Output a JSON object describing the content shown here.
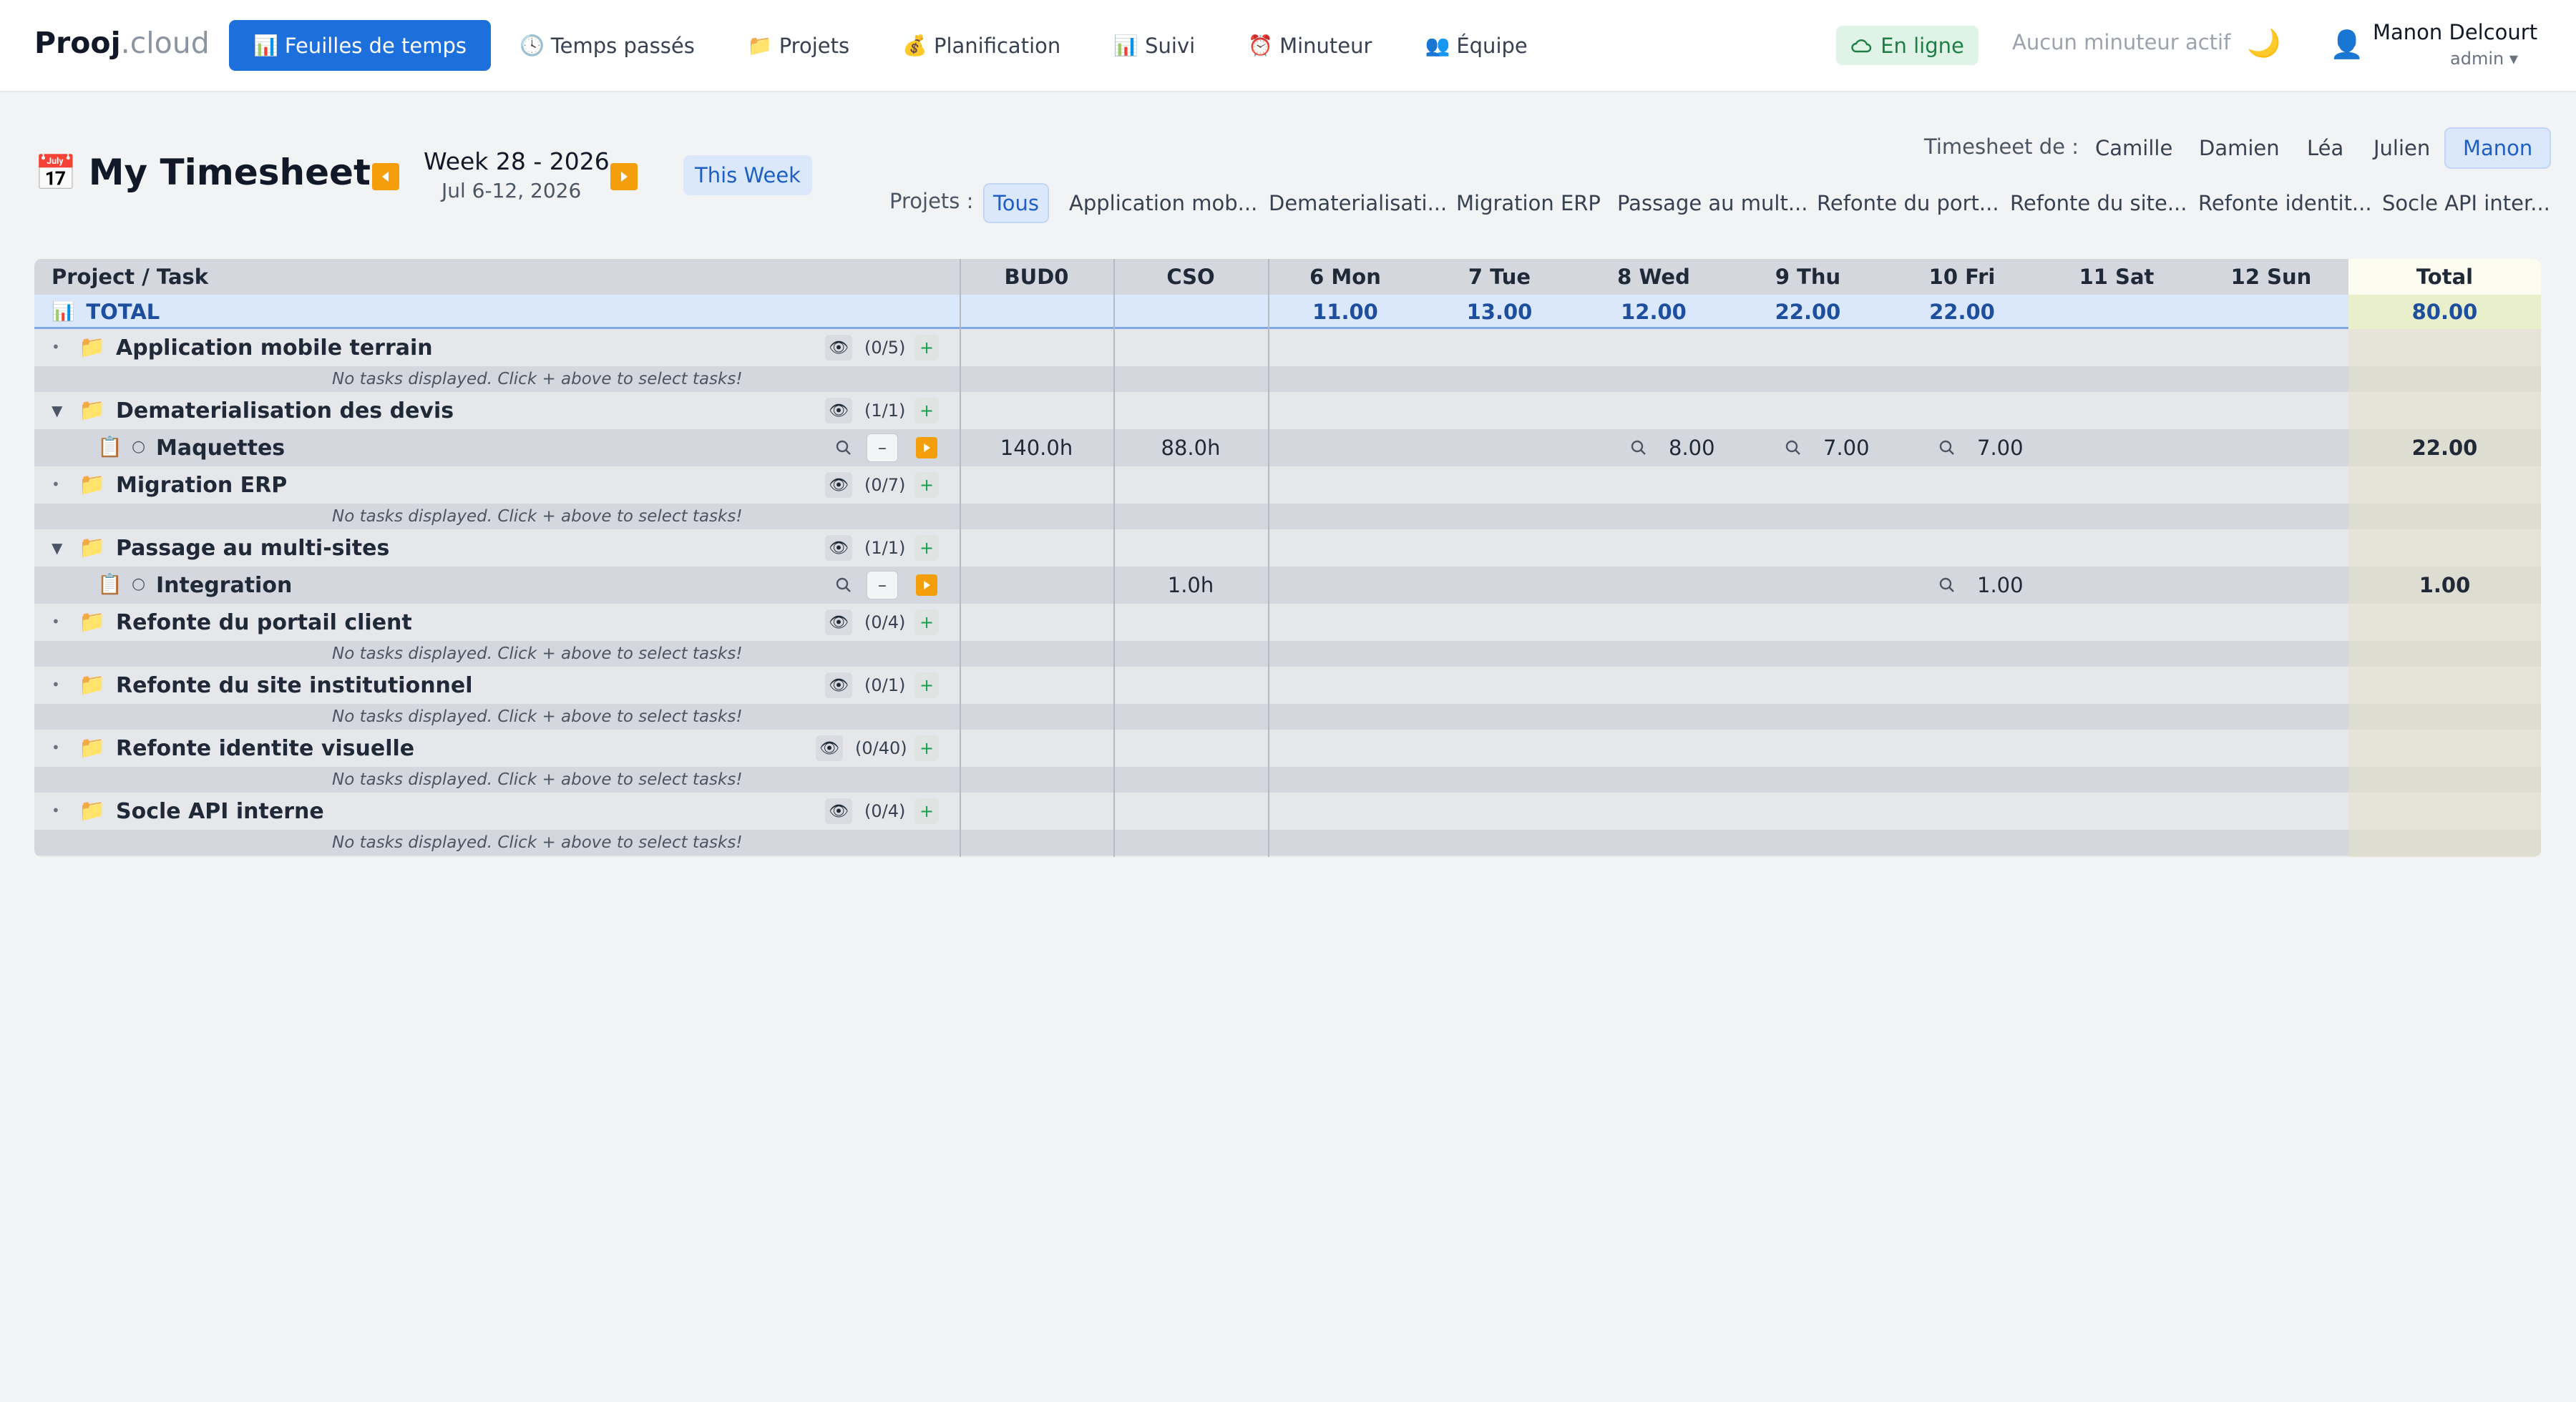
{
  "app": {
    "logo_bold": "Prooj",
    "logo_dim": ".cloud"
  },
  "nav": {
    "items": [
      {
        "icon": "📊",
        "label": "Feuilles de temps",
        "active": true
      },
      {
        "icon": "🕓",
        "label": "Temps passés"
      },
      {
        "icon": "📁",
        "label": "Projets"
      },
      {
        "icon": "💰",
        "label": "Planification"
      },
      {
        "icon": "📊",
        "label": "Suivi"
      },
      {
        "icon": "⏰",
        "label": "Minuteur"
      },
      {
        "icon": "👥",
        "label": "Équipe"
      }
    ],
    "status": "En ligne",
    "timer": "Aucun minuteur actif",
    "user_name": "Manon Delcourt",
    "user_role": "admin ▾"
  },
  "header": {
    "title": "My Timesheet",
    "week": "Week 28 - 2026",
    "dates": "Jul 6-12, 2026",
    "this_week": "This Week",
    "timesheet_of_label": "Timesheet de :",
    "people": [
      "Camille",
      "Damien",
      "Léa",
      "Julien",
      "Manon"
    ],
    "active_person": "Manon",
    "projects_label": "Projets :",
    "project_filters": [
      "Tous",
      "Application mob...",
      "Dematerialisati...",
      "Migration ERP",
      "Passage au mult...",
      "Refonte du port...",
      "Refonte du site...",
      "Refonte identit...",
      "Socle API inter..."
    ],
    "active_filter": "Tous"
  },
  "grid": {
    "columns": {
      "task": "Project / Task",
      "bud": "BUD0",
      "cso": "CSO",
      "days": [
        "6 Mon",
        "7 Tue",
        "8 Wed",
        "9 Thu",
        "10 Fri",
        "11 Sat",
        "12 Sun"
      ],
      "total": "Total"
    },
    "total_row": {
      "label": "TOTAL",
      "days": [
        "11.00",
        "13.00",
        "12.00",
        "22.00",
        "22.00",
        "",
        ""
      ],
      "total": "80.00"
    },
    "note_text": "No tasks displayed. Click + above to select tasks!",
    "projects": [
      {
        "name": "Application mobile terrain",
        "count": "(0/5)",
        "expanded": false
      },
      {
        "name": "Dematerialisation des devis",
        "count": "(1/1)",
        "expanded": true,
        "task": {
          "name": "Maquettes",
          "bud": "140.0h",
          "cso": "88.0h",
          "days": [
            "",
            "",
            "8.00",
            "7.00",
            "7.00",
            "",
            ""
          ],
          "total": "22.00"
        }
      },
      {
        "name": "Migration ERP",
        "count": "(0/7)",
        "expanded": false
      },
      {
        "name": "Passage au multi-sites",
        "count": "(1/1)",
        "expanded": true,
        "task": {
          "name": "Integration",
          "bud": "",
          "cso": "1.0h",
          "days": [
            "",
            "",
            "",
            "",
            "1.00",
            "",
            ""
          ],
          "total": "1.00"
        }
      },
      {
        "name": "Refonte du portail client",
        "count": "(0/4)",
        "expanded": false
      },
      {
        "name": "Refonte du site institutionnel",
        "count": "(0/1)",
        "expanded": false
      },
      {
        "name": "Refonte identite visuelle",
        "count": "(0/40)",
        "expanded": false
      },
      {
        "name": "Socle API interne",
        "count": "(0/4)",
        "expanded": false
      }
    ]
  }
}
